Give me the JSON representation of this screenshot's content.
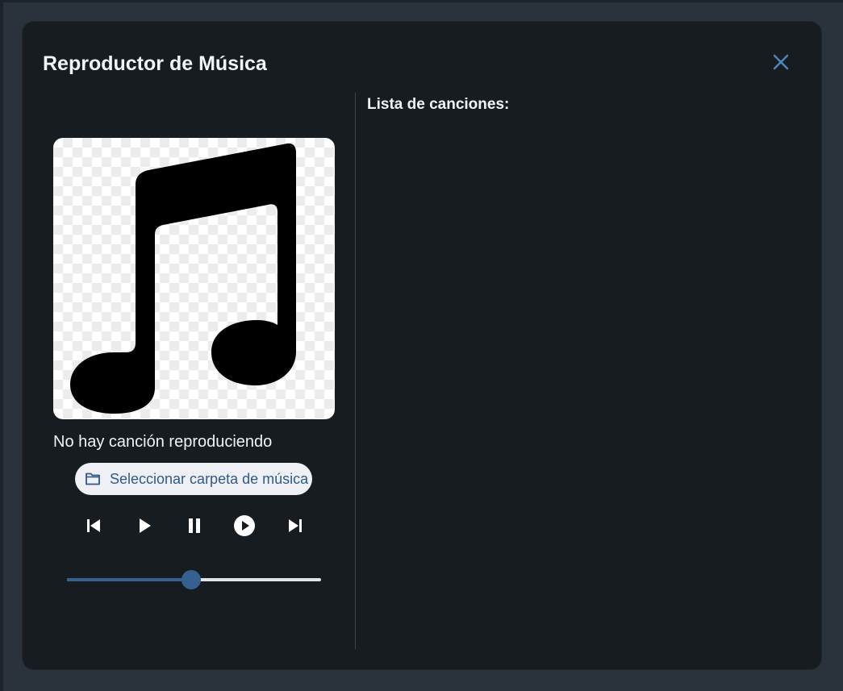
{
  "dialog": {
    "title": "Reproductor de Música",
    "close_icon": "close-icon"
  },
  "player": {
    "album_art_icon": "music-note-icon",
    "now_playing": "No hay canción reproduciendo",
    "select_folder_label": "Seleccionar carpeta de música",
    "select_folder_icon": "folder-icon",
    "controls": [
      {
        "name": "previous",
        "icon": "skip-previous-icon"
      },
      {
        "name": "play",
        "icon": "play-icon"
      },
      {
        "name": "pause",
        "icon": "pause-icon"
      },
      {
        "name": "play-circle",
        "icon": "play-circle-icon"
      },
      {
        "name": "next",
        "icon": "skip-next-icon"
      }
    ],
    "progress": 0.49
  },
  "playlist": {
    "title": "Lista de canciones:",
    "songs": []
  },
  "colors": {
    "dialog_bg": "#171c21",
    "accent": "#35608f",
    "button_bg": "#eef0f6",
    "text": "#f3f4f6"
  }
}
